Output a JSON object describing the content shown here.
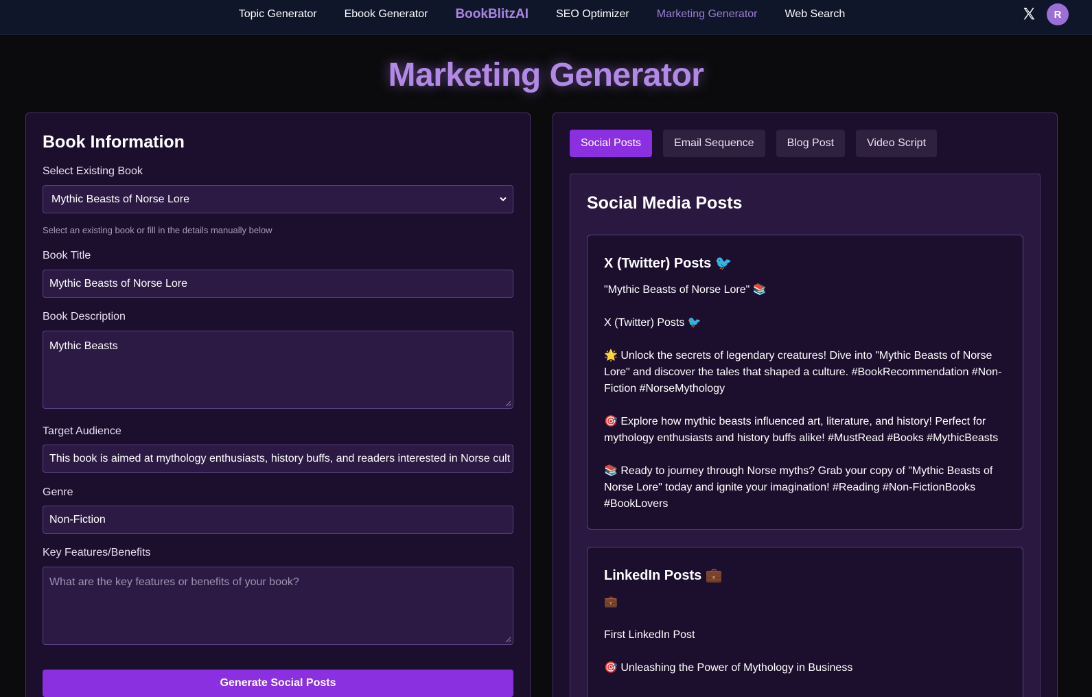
{
  "nav": {
    "links": [
      "Topic Generator",
      "Ebook Generator",
      "BookBlitzAI",
      "SEO Optimizer",
      "Marketing Generator",
      "Web Search"
    ],
    "avatar_initial": "R"
  },
  "page": {
    "title": "Marketing Generator"
  },
  "left_panel": {
    "title": "Book Information",
    "select_label": "Select Existing Book",
    "select_value": "Mythic Beasts of Norse Lore",
    "select_hint": "Select an existing book or fill in the details manually below",
    "book_title_label": "Book Title",
    "book_title_value": "Mythic Beasts of Norse Lore",
    "description_label": "Book Description",
    "description_value": "Mythic Beasts",
    "audience_label": "Target Audience",
    "audience_value": "This book is aimed at mythology enthusiasts, history buffs, and readers interested in Norse cult",
    "genre_label": "Genre",
    "genre_value": "Non-Fiction",
    "features_label": "Key Features/Benefits",
    "features_placeholder": "What are the key features or benefits of your book?",
    "generate_button": "Generate Social Posts"
  },
  "right_panel": {
    "tabs": [
      "Social Posts",
      "Email Sequence",
      "Blog Post",
      "Video Script"
    ],
    "active_tab": "Social Posts",
    "section_title": "Social Media Posts",
    "twitter_card": {
      "title": "X (Twitter) Posts 🐦",
      "paragraphs": [
        "\"Mythic Beasts of Norse Lore\" 📚",
        "X (Twitter) Posts 🐦",
        "🌟 Unlock the secrets of legendary creatures! Dive into \"Mythic Beasts of Norse Lore\" and discover the tales that shaped a culture. #BookRecommendation #Non-Fiction #NorseMythology",
        "🎯 Explore how mythic beasts influenced art, literature, and history! Perfect for mythology enthusiasts and history buffs alike! #MustRead #Books #MythicBeasts",
        "📚 Ready to journey through Norse myths? Grab your copy of \"Mythic Beasts of Norse Lore\" today and ignite your imagination! #Reading #Non-FictionBooks #BookLovers"
      ]
    },
    "linkedin_card": {
      "title": "LinkedIn Posts 💼",
      "paragraphs": [
        "💼",
        "First LinkedIn Post",
        "🎯 Unleashing the Power of Mythology in Business"
      ]
    }
  },
  "colors": {
    "accent": "#8b30e0",
    "brand": "#a985e0",
    "panel_bg": "#1c0f2e",
    "nav_bg": "#0f1629"
  }
}
